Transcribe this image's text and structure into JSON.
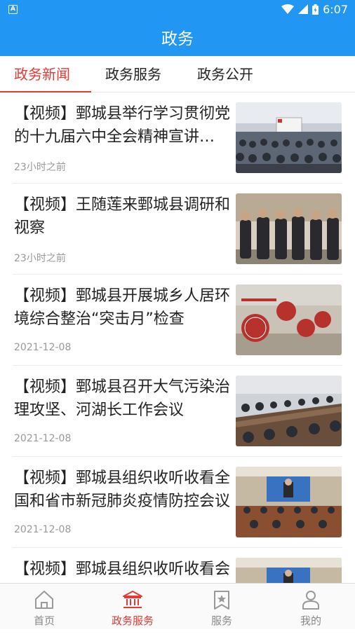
{
  "status_bar": {
    "time": "6:07",
    "app_badge": "A"
  },
  "header": {
    "title": "政务"
  },
  "tabs": [
    {
      "label": "政务新闻",
      "active": true
    },
    {
      "label": "政务服务",
      "active": false
    },
    {
      "label": "政务公开",
      "active": false
    }
  ],
  "news": [
    {
      "title": "【视频】鄄城县举行学习贯彻党的十九届六中全会精神宣讲报告会",
      "date": "23小时之前",
      "thumb": "meeting-hall-photo"
    },
    {
      "title": "【视频】王随莲来鄄城县调研和视察",
      "date": "23小时之前",
      "thumb": "officials-visit-photo"
    },
    {
      "title": "【视频】鄄城县开展城乡人居环境综合整治“突击月”检查",
      "date": "2021-12-08",
      "thumb": "civilization-signs-photo"
    },
    {
      "title": "【视频】鄄城县召开大气污染治理攻坚、河湖长工作会议",
      "date": "2021-12-08",
      "thumb": "conference-table-photo"
    },
    {
      "title": "【视频】鄄城县组织收听收看全国和省市新冠肺炎疫情防控会议",
      "date": "2021-12-08",
      "thumb": "video-conference-photo"
    },
    {
      "title": "【视频】鄄城县组织收听收看会议",
      "date": "",
      "thumb": "video-conference-photo"
    }
  ],
  "bottom_nav": [
    {
      "label": "首页",
      "icon": "home-icon",
      "active": false
    },
    {
      "label": "政务服务",
      "icon": "government-building-icon",
      "active": true
    },
    {
      "label": "服务",
      "icon": "bookmark-star-icon",
      "active": false
    },
    {
      "label": "我的",
      "icon": "user-icon",
      "active": false
    }
  ],
  "colors": {
    "primary": "#2196f3",
    "accent": "#e53935"
  }
}
